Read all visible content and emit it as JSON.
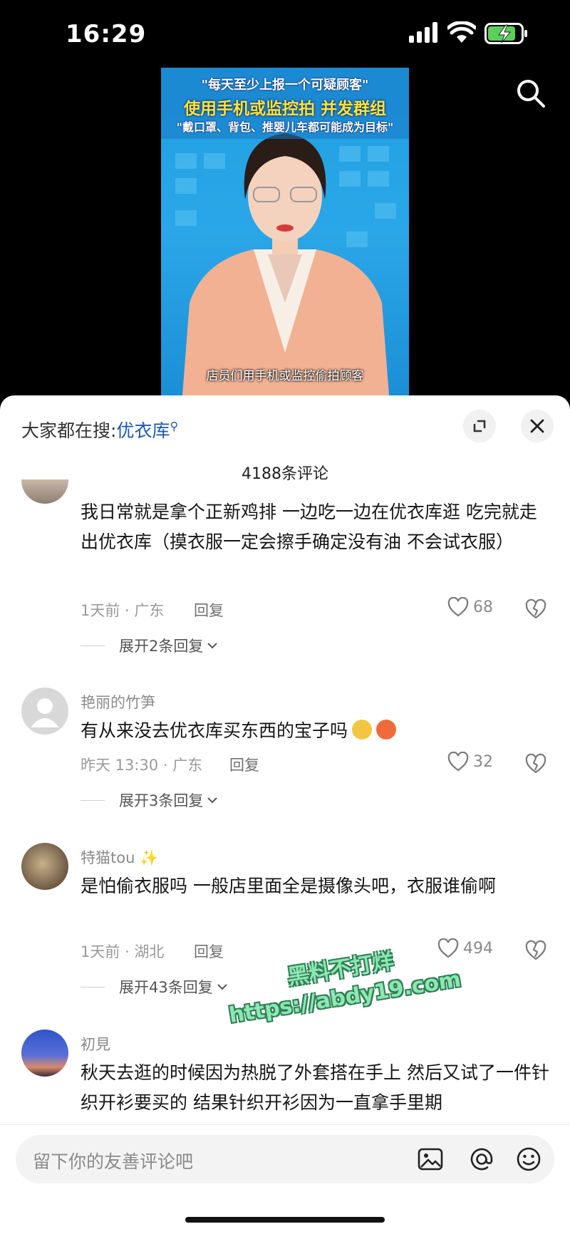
{
  "status_bar": {
    "time": "16:29"
  },
  "video": {
    "headline_1": "\"每天至少上报一个可疑顾客\"",
    "headline_2": "使用手机或监控拍 并发群组",
    "headline_3": "\"戴口罩、背包、推婴儿车都可能成为目标\"",
    "caption": "店员们用手机或监控偷拍顾客"
  },
  "sheet": {
    "trend_prefix": "大家都在搜:",
    "trend_keyword": "优衣库",
    "comment_count": "4188条评论"
  },
  "comments": [
    {
      "text": "我日常就是拿个正新鸡排 一边吃一边在优衣库逛 吃完就走出优衣库（摸衣服一定会擦手确定没有油 不会试衣服）",
      "time_loc": "1天前 · 广东",
      "reply": "回复",
      "likes": "68",
      "expand": "展开2条回复"
    },
    {
      "user": "艳丽的竹笋",
      "text": "有从来没去优衣库买东西的宝子吗",
      "time_loc": "昨天 13:30 · 广东",
      "reply": "回复",
      "likes": "32",
      "expand": "展开3条回复"
    },
    {
      "user": "特猫tou",
      "text": "是怕偷衣服吗 一般店里面全是摄像头吧，衣服谁偷啊",
      "time_loc": "1天前 · 湖北",
      "reply": "回复",
      "likes": "494",
      "expand": "展开43条回复"
    },
    {
      "user": "初見",
      "text": "秋天去逛的时候因为热脱了外套搭在手上 然后又试了一件针织开衫要买的 结果针织开衫因为一直拿手里期"
    }
  ],
  "watermark": {
    "line1": "黑料不打烊",
    "line2": "https://abdy19.com"
  },
  "input": {
    "placeholder": "留下你的友善评论吧"
  }
}
